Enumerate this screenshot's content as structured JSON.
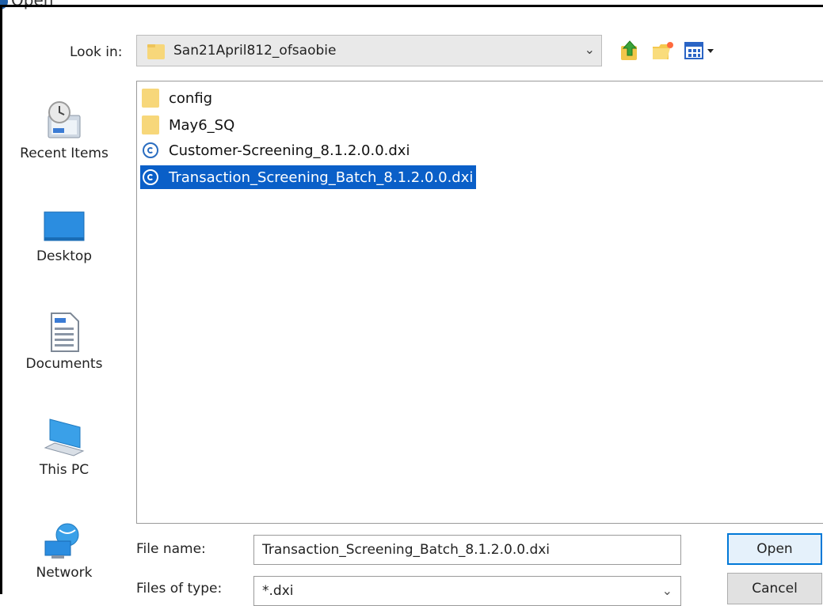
{
  "window": {
    "title": "Open"
  },
  "lookin": {
    "label": "Look in:",
    "value": "San21April812_ofsaobie"
  },
  "toolbar": {
    "up_icon": "up-folder-icon",
    "new_folder_icon": "new-folder-icon",
    "view_icon": "view-menu-icon"
  },
  "places": [
    {
      "label": "Recent Items",
      "icon": "recent-items-icon"
    },
    {
      "label": "Desktop",
      "icon": "desktop-icon"
    },
    {
      "label": "Documents",
      "icon": "documents-icon"
    },
    {
      "label": "This PC",
      "icon": "this-pc-icon"
    },
    {
      "label": "Network",
      "icon": "network-icon"
    }
  ],
  "files": [
    {
      "name": "config",
      "type": "folder"
    },
    {
      "name": "May6_SQ",
      "type": "folder"
    },
    {
      "name": "Customer-Screening_8.1.2.0.0.dxi",
      "type": "dxi"
    },
    {
      "name": "Transaction_Screening_Batch_8.1.2.0.0.dxi",
      "type": "dxi",
      "selected": true
    }
  ],
  "filename": {
    "label": "File name:",
    "value": "Transaction_Screening_Batch_8.1.2.0.0.dxi"
  },
  "filetype": {
    "label": "Files of type:",
    "value": "*.dxi"
  },
  "buttons": {
    "open": "Open",
    "cancel": "Cancel"
  },
  "colors": {
    "selection": "#0a5fc8",
    "folder": "#f7d77a",
    "default_button_border": "#0078d7"
  }
}
